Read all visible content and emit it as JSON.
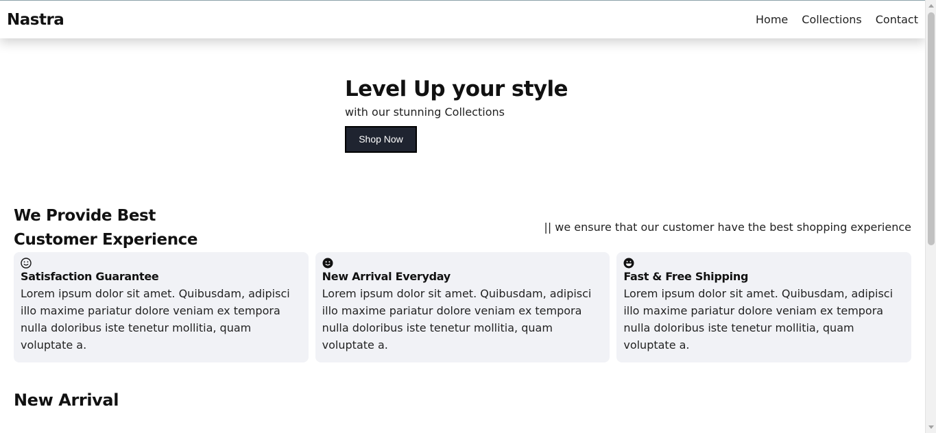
{
  "header": {
    "logo": "Nastra",
    "nav": [
      "Home",
      "Collections",
      "Contact"
    ]
  },
  "hero": {
    "title": "Level Up your style",
    "subtitle": "with our stunning Collections",
    "button": "Shop Now"
  },
  "features": {
    "title_line1": "We Provide Best",
    "title_line2": "Customer Experience",
    "tagline": "|| we ensure that our customer have the best shopping experience",
    "cards": [
      {
        "icon": "smile-outline-icon",
        "title": "Satisfaction Guarantee",
        "text": "Lorem ipsum dolor sit amet. Quibusdam, adipisci illo maxime pariatur dolore veniam ex tempora nulla doloribus iste tenetur mollitia, quam voluptate a."
      },
      {
        "icon": "smile-filled-icon",
        "title": "New Arrival Everyday",
        "text": "Lorem ipsum dolor sit amet. Quibusdam, adipisci illo maxime pariatur dolore veniam ex tempora nulla doloribus iste tenetur mollitia, quam voluptate a."
      },
      {
        "icon": "grin-icon",
        "title": "Fast & Free Shipping",
        "text": "Lorem ipsum dolor sit amet. Quibusdam, adipisci illo maxime pariatur dolore veniam ex tempora nulla doloribus iste tenetur mollitia, quam voluptate a."
      }
    ]
  },
  "new_arrival": {
    "title": "New Arrival"
  }
}
